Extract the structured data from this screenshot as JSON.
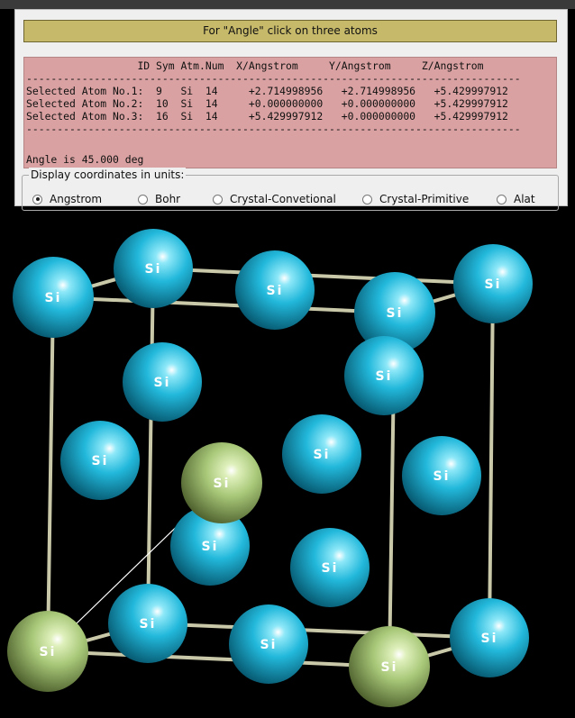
{
  "instruction": "For \"Angle\" click on three atoms",
  "console": {
    "lines": [
      "                  ID Sym Atm.Num  X/Angstrom     Y/Angstrom     Z/Angstrom",
      "--------------------------------------------------------------------------------",
      "Selected Atom No.1:  9   Si  14     +2.714998956   +2.714998956   +5.429997912",
      "Selected Atom No.2:  10  Si  14     +0.000000000   +0.000000000   +5.429997912",
      "Selected Atom No.3:  16  Si  14     +5.429997912   +0.000000000   +5.429997912",
      "--------------------------------------------------------------------------------",
      "",
      "Angle is 45.000 deg"
    ]
  },
  "units": {
    "legend": "Display coordinates in units:",
    "options": [
      {
        "label": "Angstrom",
        "selected": true
      },
      {
        "label": "Bohr",
        "selected": false
      },
      {
        "label": "Crystal-Convetional",
        "selected": false
      },
      {
        "label": "Crystal-Primitive",
        "selected": false
      },
      {
        "label": "Alat",
        "selected": false
      }
    ]
  },
  "viewer": {
    "atom_symbol": "Si",
    "colors": {
      "atom": "#1fb4d6",
      "selected_atom": "#a8c878",
      "bond": "#c9c9a9",
      "background": "#000000"
    },
    "atoms": [
      {
        "label": "Si",
        "selected": false
      },
      {
        "label": "Si",
        "selected": false
      },
      {
        "label": "Si",
        "selected": false
      },
      {
        "label": "Si",
        "selected": false
      },
      {
        "label": "Si",
        "selected": false
      },
      {
        "label": "Si",
        "selected": false
      },
      {
        "label": "Si",
        "selected": false
      },
      {
        "label": "Si",
        "selected": false
      },
      {
        "label": "Si",
        "selected": false
      },
      {
        "label": "Si",
        "selected": false
      },
      {
        "label": "Si",
        "selected": false
      },
      {
        "label": "Si",
        "selected": true
      },
      {
        "label": "Si",
        "selected": false
      },
      {
        "label": "Si",
        "selected": false
      },
      {
        "label": "Si",
        "selected": false
      },
      {
        "label": "Si",
        "selected": false
      },
      {
        "label": "Si",
        "selected": true
      },
      {
        "label": "Si",
        "selected": false
      },
      {
        "label": "Si",
        "selected": true
      },
      {
        "label": "Si",
        "selected": false
      }
    ]
  }
}
